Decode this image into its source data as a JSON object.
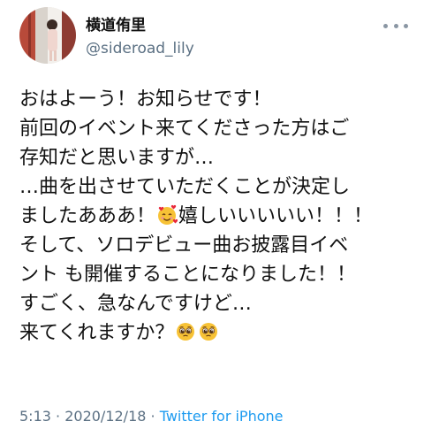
{
  "header": {
    "display_name": "横道侑里",
    "handle": "@sideroad_lily",
    "avatar_icon": "avatar",
    "more_icon": "more-icon"
  },
  "tweet": {
    "lines": [
      "おはよーう！お知らせです！",
      "前回のイベント来てくださった方はご",
      "存知だと思いますが…",
      "…曲を出させていただくことが決定し",
      "ましたあああ！",
      "嬉しいいいいい！！！",
      "そして、ソロデビュー曲お披露目イベ",
      "ント も開催することになりました！！",
      "すごく、急なんですけど…",
      "来てくれますか？"
    ],
    "emojis": {
      "smiling_hearts": "smiling-face-with-hearts-icon",
      "pleading": "pleading-face-icon"
    }
  },
  "footer": {
    "time": "5:13",
    "separator1": " · ",
    "date": "2020/12/18",
    "separator2": " · ",
    "source": "Twitter for iPhone"
  },
  "colors": {
    "text": "#111111",
    "secondary": "#5b7083",
    "link": "#1d9bf0"
  }
}
